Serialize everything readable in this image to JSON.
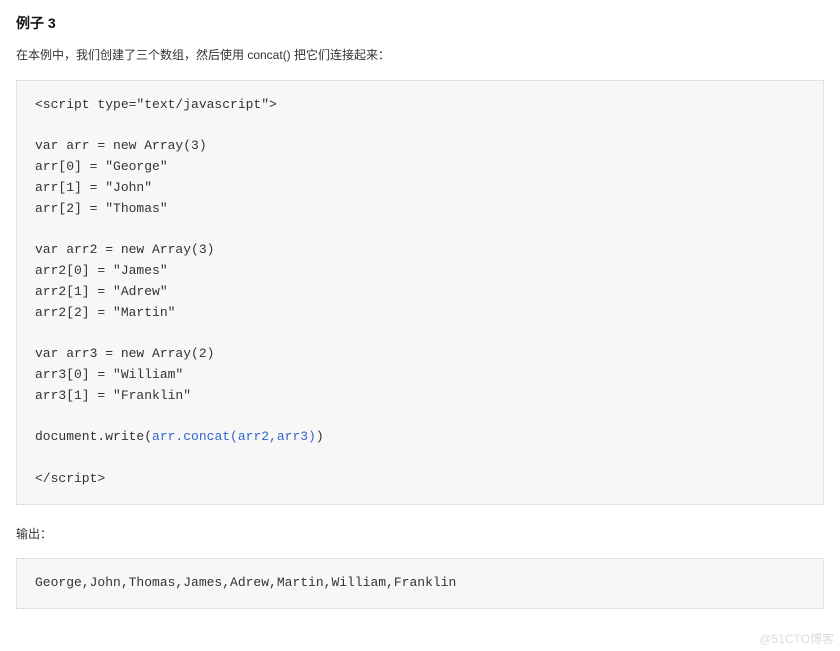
{
  "heading": "例子 3",
  "intro": "在本例中，我们创建了三个数组，然后使用 concat() 把它们连接起来：",
  "code": {
    "line01": "<script type=\"text/javascript\">",
    "line02": "",
    "line03": "var arr = new Array(3)",
    "line04": "arr[0] = \"George\"",
    "line05": "arr[1] = \"John\"",
    "line06": "arr[2] = \"Thomas\"",
    "line07": "",
    "line08": "var arr2 = new Array(3)",
    "line09": "arr2[0] = \"James\"",
    "line10": "arr2[1] = \"Adrew\"",
    "line11": "arr2[2] = \"Martin\"",
    "line12": "",
    "line13": "var arr3 = new Array(2)",
    "line14": "arr3[0] = \"William\"",
    "line15": "arr3[1] = \"Franklin\"",
    "line16": "",
    "line17a": "document.write(",
    "line17b": "arr.concat(arr2,arr3)",
    "line17c": ")",
    "line18": "",
    "line19": "</script>"
  },
  "output_label": "输出：",
  "output_value": "George,John,Thomas,James,Adrew,Martin,William,Franklin",
  "watermark": "@51CTO博客"
}
